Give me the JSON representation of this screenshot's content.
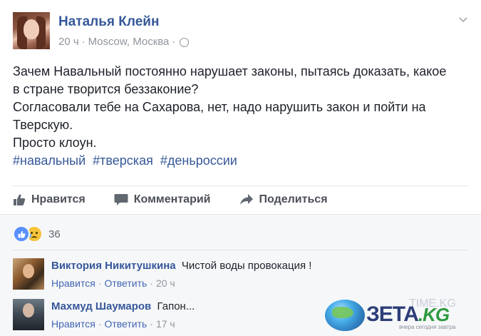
{
  "post": {
    "author": "Наталья Клейн",
    "time": "20 ч",
    "location": "Moscow, Москва",
    "meta_separator": "·",
    "lines": [
      "Зачем Навальный постоянно нарушает законы, пытаясь доказать, какое",
      "в стране творится беззаконие?",
      "Согласовали тебе на Сахарова, нет, надо нарушить закон и пойти на",
      "Тверскую.",
      "Просто клоун."
    ],
    "hashtags": [
      "#навальный",
      "#тверская",
      "#деньроссии"
    ]
  },
  "actions": {
    "like": "Нравится",
    "comment": "Комментарий",
    "share": "Поделиться"
  },
  "reactions": {
    "count": "36",
    "icons": [
      "like-icon",
      "sad-icon"
    ]
  },
  "comments": [
    {
      "author": "Виктория Никитушкина",
      "text": "Чистой воды провокация !",
      "like": "Нравится",
      "reply": "Ответить",
      "sep": "·",
      "time": "20 ч"
    },
    {
      "author": "Махмуд Шаумаров",
      "text": "Гапон...",
      "like": "Нравится",
      "reply": "Ответить",
      "sep": "·",
      "time": "17 ч"
    }
  ],
  "watermark": {
    "brand": "ЗЕТА",
    "domain": ".KG",
    "ghost": "TIME.KG",
    "tagline": "вчера сегодня завтра"
  },
  "colors": {
    "link": "#365899",
    "meta": "#90949c",
    "text": "#1d2129",
    "comments_bg": "#f6f7f9"
  }
}
